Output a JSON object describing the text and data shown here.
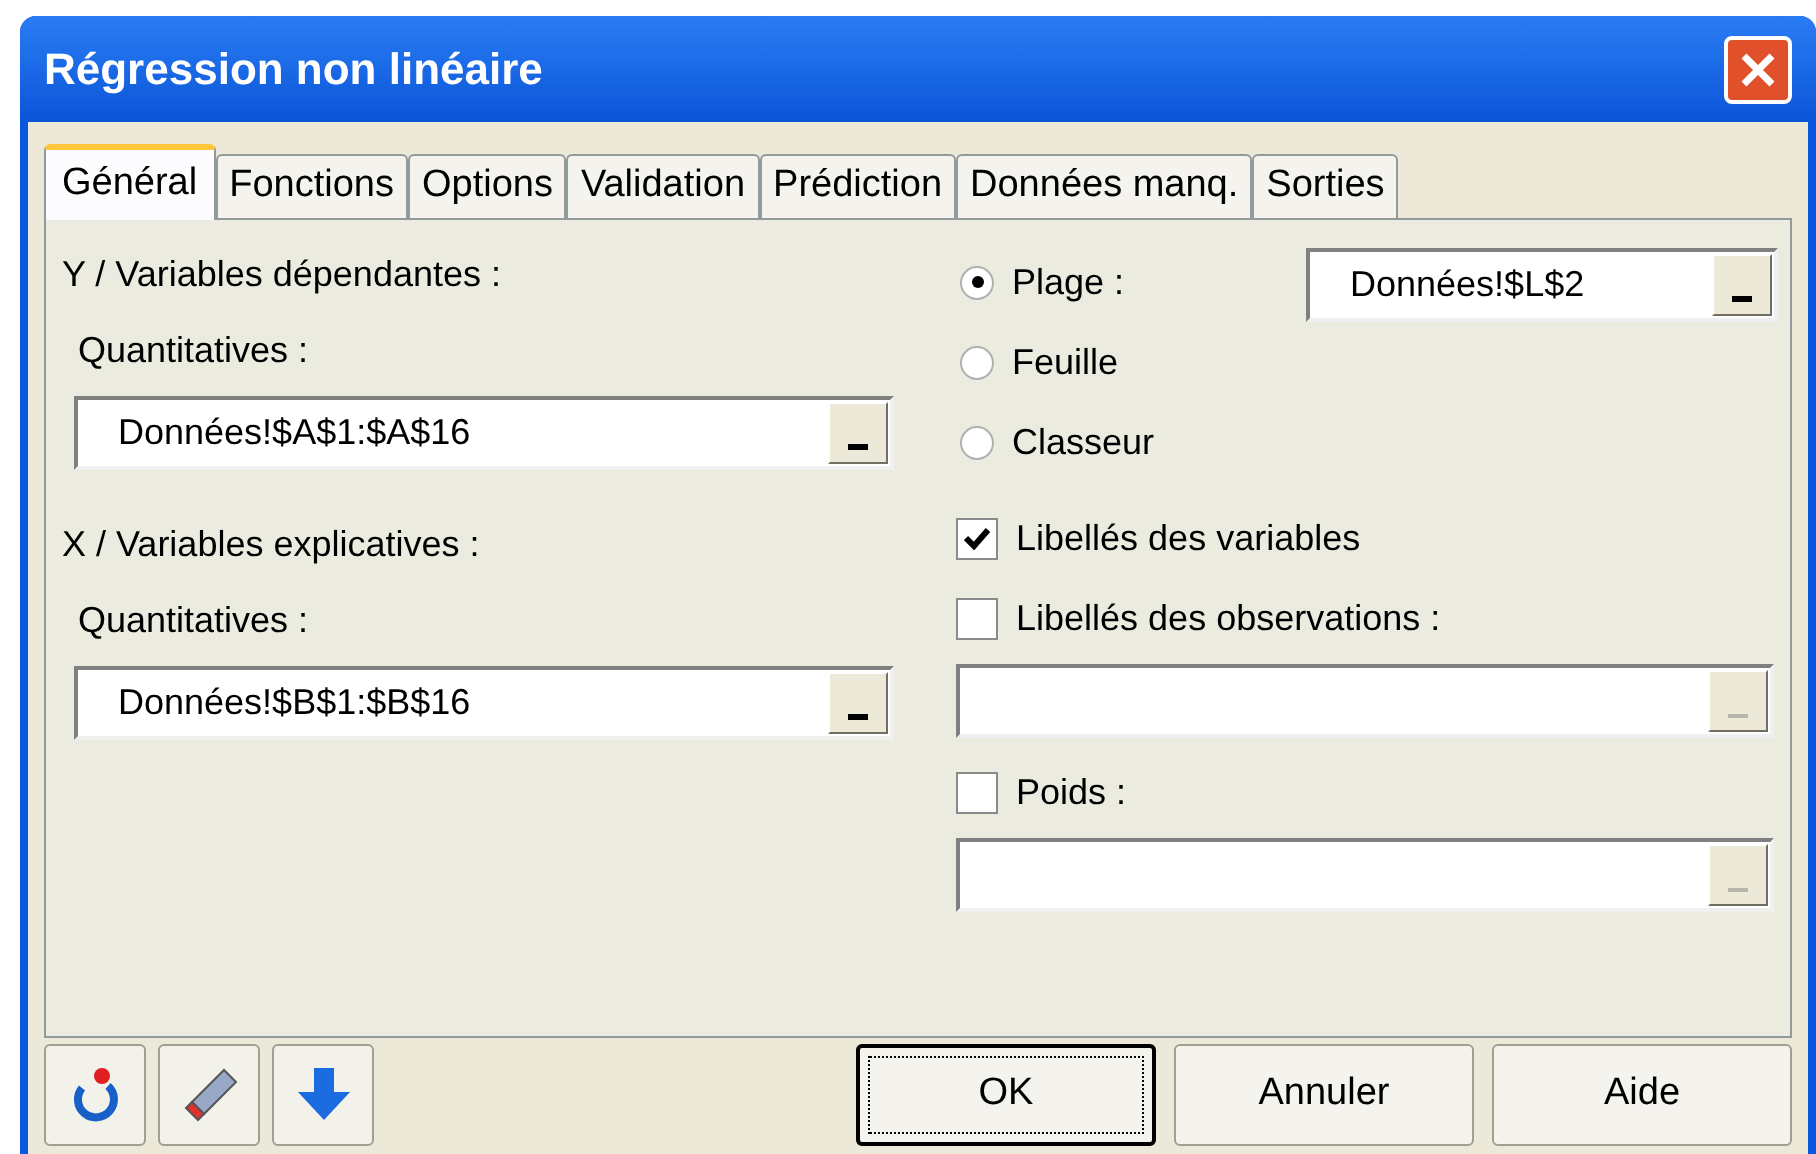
{
  "window": {
    "title": "Régression non linéaire"
  },
  "tabs": [
    {
      "label": "Général",
      "selected": true
    },
    {
      "label": "Fonctions",
      "selected": false
    },
    {
      "label": "Options",
      "selected": false
    },
    {
      "label": "Validation",
      "selected": false
    },
    {
      "label": "Prédiction",
      "selected": false
    },
    {
      "label": "Données manq.",
      "selected": false
    },
    {
      "label": "Sorties",
      "selected": false
    }
  ],
  "variable_groups": [
    {
      "label": "Y / Variables dépendantes :",
      "sublabel": "Quantitatives :",
      "field": {
        "value": "Données!$A$1:$A$16",
        "disabled": false
      }
    },
    {
      "label": "X / Variables explicatives :",
      "sublabel": "Quantitatives :",
      "field": {
        "value": "Données!$B$1:$B$16",
        "disabled": false
      }
    }
  ],
  "range_options": [
    {
      "label": "Plage :",
      "selected": true
    },
    {
      "label": "Feuille",
      "selected": false
    },
    {
      "label": "Classeur",
      "selected": false
    }
  ],
  "range_field": {
    "value": "Données!$L$2",
    "disabled": false
  },
  "options": [
    {
      "label": "Libellés des variables",
      "checked": true
    },
    {
      "label": "Libellés des observations :",
      "checked": false,
      "field": {
        "disabled": true
      }
    },
    {
      "label": "Poids :",
      "checked": false,
      "field": {
        "disabled": true
      }
    }
  ],
  "tool_buttons": [
    {
      "kind": "reset"
    },
    {
      "kind": "eraser"
    },
    {
      "kind": "down"
    }
  ],
  "buttons": [
    {
      "label": "OK",
      "default": true
    },
    {
      "label": "Annuler",
      "default": false
    },
    {
      "label": "Aide",
      "default": false
    }
  ]
}
